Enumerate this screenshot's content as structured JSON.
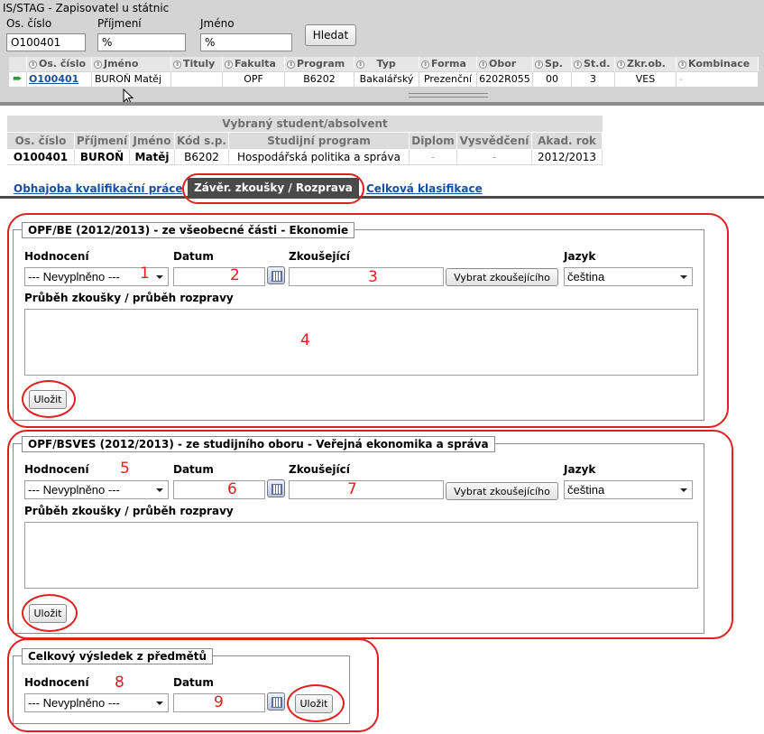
{
  "app": {
    "title": "IS/STAG - Zapisovatel u státnic"
  },
  "search": {
    "os_cislo_label": "Os. číslo",
    "prijmeni_label": "Příjmení",
    "jmeno_label": "Jméno",
    "os_cislo_value": "O100401",
    "prijmeni_value": "%",
    "jmeno_value": "%",
    "button_label": "Hledat"
  },
  "results": {
    "columns": [
      "Os. číslo",
      "Jméno",
      "Tituly",
      "Fakulta",
      "Program",
      "Typ",
      "Forma",
      "Obor",
      "Sp.",
      "St.d.",
      "Zkr.ob.",
      "Kombinace"
    ],
    "row": {
      "os_cislo": "O100401",
      "prijmeni": "BUROŇ",
      "jmeno": "Matěj",
      "tituly": "",
      "fakulta": "OPF",
      "program": "B6202",
      "typ": "Bakalářský",
      "forma": "Prezenční",
      "obor": "6202R055",
      "sp": "00",
      "std": "3",
      "zkrob": "VES",
      "kombinace": "-"
    }
  },
  "student": {
    "title": "Vybraný student/absolvent",
    "columns": [
      "Os. číslo",
      "Příjmení",
      "Jméno",
      "Kód s.p.",
      "Studijní program",
      "Diplom",
      "Vysvědčení",
      "Akad. rok"
    ],
    "values": [
      "O100401",
      "BUROŇ",
      "Matěj",
      "B6202",
      "Hospodářská politika a správa",
      "-",
      "-",
      "2012/2013"
    ]
  },
  "tabs": {
    "tab1": "Obhajoba kvalifikační práce",
    "tab2": "Závěr. zkoušky / Rozprava",
    "tab3": "Celková klasifikace"
  },
  "section1": {
    "legend": "OPF/BE (2012/2013) - ze všeobecné části - Ekonomie",
    "hodnoceni_label": "Hodnocení",
    "datum_label": "Datum",
    "zkousejici_label": "Zkoušející",
    "jazyk_label": "Jazyk",
    "hodnoceni_value": "--- Nevyplněno ---",
    "vybrat_label": "Vybrat zkoušejícího",
    "jazyk_value": "čeština",
    "prubeh_label": "Průběh zkoušky / průběh rozpravy",
    "save_label": "Uložit"
  },
  "section2": {
    "legend": "OPF/BSVES (2012/2013) - ze studijního oboru - Veřejná ekonomika a správa",
    "hodnoceni_label": "Hodnocení",
    "datum_label": "Datum",
    "zkousejici_label": "Zkoušející",
    "jazyk_label": "Jazyk",
    "hodnoceni_value": "--- Nevyplněno ---",
    "vybrat_label": "Vybrat zkoušejícího",
    "jazyk_value": "čeština",
    "prubeh_label": "Průběh zkoušky / průběh rozpravy",
    "save_label": "Uložit"
  },
  "section3": {
    "legend": "Celkový výsledek z předmětů",
    "hodnoceni_label": "Hodnocení",
    "datum_label": "Datum",
    "hodnoceni_value": "--- Nevyplněno ---",
    "save_label": "Uložit"
  },
  "annotations": {
    "n1": "1",
    "n2": "2",
    "n3": "3",
    "n4": "4",
    "n5": "5",
    "n6": "6",
    "n7": "7",
    "n8": "8",
    "n9": "9"
  },
  "colors": {
    "annotation": "#e02020",
    "active_tab": "#4a4a4a",
    "link": "#1a4f99",
    "panel_bg": "#d4d4d4"
  }
}
